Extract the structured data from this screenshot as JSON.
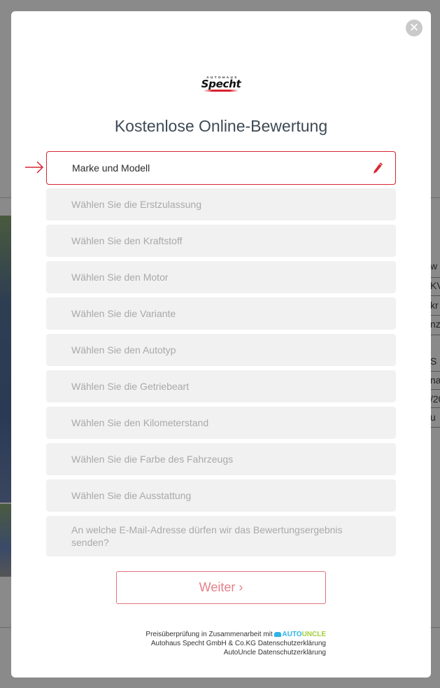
{
  "modal": {
    "title": "Kostenlose Online-Bewertung",
    "logo": {
      "top": "AUTOHAUS",
      "main": "Specht"
    },
    "fields": [
      {
        "label": "Marke und Modell",
        "active": true
      },
      {
        "label": "Wählen Sie die Erstzulassung"
      },
      {
        "label": "Wählen Sie den Kraftstoff"
      },
      {
        "label": "Wählen Sie den Motor"
      },
      {
        "label": "Wählen Sie die Variante"
      },
      {
        "label": "Wählen Sie den Autotyp"
      },
      {
        "label": "Wählen Sie die Getriebeart"
      },
      {
        "label": "Wählen Sie den Kilometerstand"
      },
      {
        "label": "Wählen Sie die Farbe des Fahrzeugs"
      },
      {
        "label": "Wählen Sie die Ausstattung"
      },
      {
        "label": "An welche E-Mail-Adresse dürfen wir das Bewertungsergebnis senden?"
      }
    ],
    "submit_label": "Weiter ›",
    "footer": {
      "line1": "Preisüberprüfung in Zusammenarbeit mit",
      "partner_a": "AUTO",
      "partner_b": "UNCLE",
      "line2": "Autohaus Specht GmbH & Co.KG Datenschutzerklärung",
      "line3": "AutoUncle Datenschutzerklärung"
    },
    "close_icon": "close-icon"
  },
  "background": {
    "right_fragments": [
      "w",
      "KV",
      "kr",
      "nz",
      "S",
      "na",
      "/20",
      "u"
    ]
  },
  "colors": {
    "accent": "#d42830",
    "button_text": "#e58088",
    "field_bg": "#f1f1f1"
  }
}
